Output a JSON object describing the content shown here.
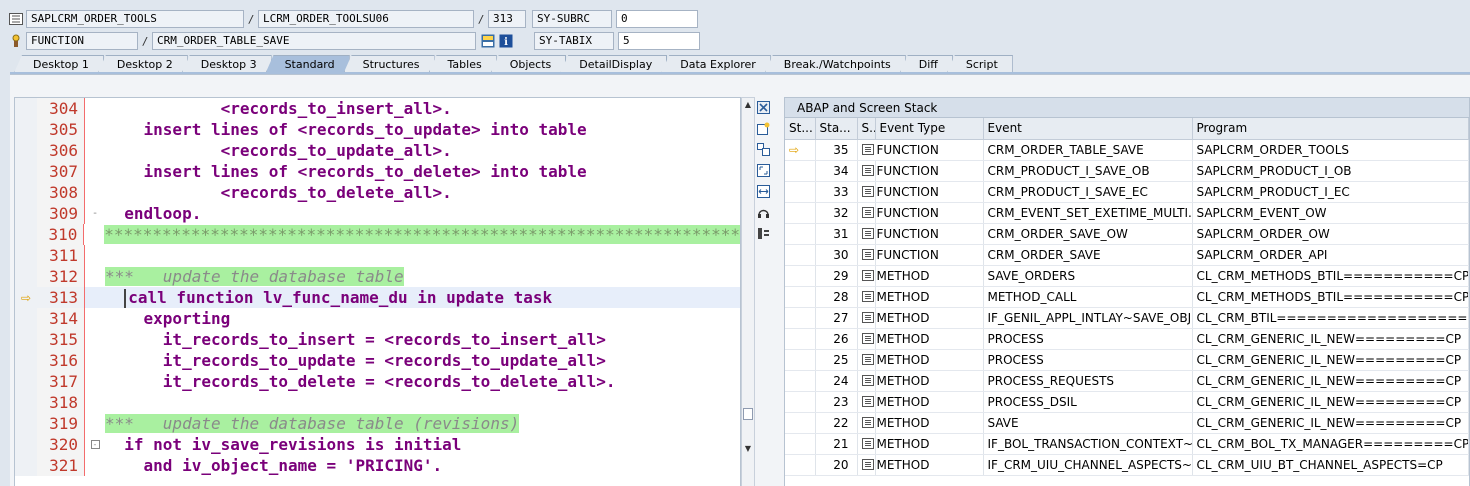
{
  "header": {
    "program": "SAPLCRM_ORDER_TOOLS",
    "include": "LCRM_ORDER_TOOLSU06",
    "line": "313",
    "sysubrc_label": "SY-SUBRC",
    "sysubrc_value": "0",
    "event_type": "FUNCTION",
    "event_name": "CRM_ORDER_TABLE_SAVE",
    "sytabix_label": "SY-TABIX",
    "sytabix_value": "5",
    "sep": "/"
  },
  "tabs": [
    "Desktop 1",
    "Desktop 2",
    "Desktop 3",
    "Standard",
    "Structures",
    "Tables",
    "Objects",
    "DetailDisplay",
    "Data Explorer",
    "Break./Watchpoints",
    "Diff",
    "Script"
  ],
  "active_tab": "Standard",
  "code": [
    {
      "num": "304",
      "text": "            <records_to_insert_all>.",
      "kind": "code"
    },
    {
      "num": "305",
      "text": "    insert lines of <records_to_update> into table",
      "kind": "code"
    },
    {
      "num": "306",
      "text": "            <records_to_update_all>.",
      "kind": "code"
    },
    {
      "num": "307",
      "text": "    insert lines of <records_to_delete> into table",
      "kind": "code"
    },
    {
      "num": "308",
      "text": "            <records_to_delete_all>.",
      "kind": "code"
    },
    {
      "num": "309",
      "text": "  endloop.",
      "kind": "code"
    },
    {
      "num": "310",
      "text": "******************************************************************",
      "kind": "stars"
    },
    {
      "num": "311",
      "text": "",
      "kind": "code"
    },
    {
      "num": "312",
      "text": "***   update the database table",
      "kind": "comment"
    },
    {
      "num": "313",
      "text": "call function lv_func_name_du in update task",
      "kind": "current"
    },
    {
      "num": "314",
      "text": "    exporting",
      "kind": "code"
    },
    {
      "num": "315",
      "text": "      it_records_to_insert = <records_to_insert_all>",
      "kind": "code"
    },
    {
      "num": "316",
      "text": "      it_records_to_update = <records_to_update_all>",
      "kind": "code"
    },
    {
      "num": "317",
      "text": "      it_records_to_delete = <records_to_delete_all>.",
      "kind": "code"
    },
    {
      "num": "318",
      "text": "",
      "kind": "code"
    },
    {
      "num": "319",
      "text": "***   update the database table (revisions)",
      "kind": "comment"
    },
    {
      "num": "320",
      "text": "  if not iv_save_revisions is initial",
      "kind": "code"
    },
    {
      "num": "321",
      "text": "    and iv_object_name = 'PRICING'.",
      "kind": "code"
    }
  ],
  "stack": {
    "title": "ABAP and Screen Stack",
    "columns": [
      "St...",
      "Sta...",
      "S...",
      "Event Type",
      "Event",
      "Program"
    ],
    "rows": [
      {
        "level": "35",
        "type": "FUNCTION",
        "event": "CRM_ORDER_TABLE_SAVE",
        "program": "SAPLCRM_ORDER_TOOLS",
        "current": true
      },
      {
        "level": "34",
        "type": "FUNCTION",
        "event": "CRM_PRODUCT_I_SAVE_OB",
        "program": "SAPLCRM_PRODUCT_I_OB"
      },
      {
        "level": "33",
        "type": "FUNCTION",
        "event": "CRM_PRODUCT_I_SAVE_EC",
        "program": "SAPLCRM_PRODUCT_I_EC"
      },
      {
        "level": "32",
        "type": "FUNCTION",
        "event": "CRM_EVENT_SET_EXETIME_MULTI...",
        "program": "SAPLCRM_EVENT_OW"
      },
      {
        "level": "31",
        "type": "FUNCTION",
        "event": "CRM_ORDER_SAVE_OW",
        "program": "SAPLCRM_ORDER_OW"
      },
      {
        "level": "30",
        "type": "FUNCTION",
        "event": "CRM_ORDER_SAVE",
        "program": "SAPLCRM_ORDER_API"
      },
      {
        "level": "29",
        "type": "METHOD",
        "event": "SAVE_ORDERS",
        "program": "CL_CRM_METHODS_BTIL===========CP"
      },
      {
        "level": "28",
        "type": "METHOD",
        "event": "METHOD_CALL",
        "program": "CL_CRM_METHODS_BTIL===========CP"
      },
      {
        "level": "27",
        "type": "METHOD",
        "event": "IF_GENIL_APPL_INTLAY~SAVE_OBJ...",
        "program": "CL_CRM_BTIL====================CP"
      },
      {
        "level": "26",
        "type": "METHOD",
        "event": "PROCESS",
        "program": "CL_CRM_GENERIC_IL_NEW=========CP"
      },
      {
        "level": "25",
        "type": "METHOD",
        "event": "PROCESS",
        "program": "CL_CRM_GENERIC_IL_NEW=========CP"
      },
      {
        "level": "24",
        "type": "METHOD",
        "event": "PROCESS_REQUESTS",
        "program": "CL_CRM_GENERIC_IL_NEW=========CP"
      },
      {
        "level": "23",
        "type": "METHOD",
        "event": "PROCESS_DSIL",
        "program": "CL_CRM_GENERIC_IL_NEW=========CP"
      },
      {
        "level": "22",
        "type": "METHOD",
        "event": "SAVE",
        "program": "CL_CRM_GENERIC_IL_NEW=========CP"
      },
      {
        "level": "21",
        "type": "METHOD",
        "event": "IF_BOL_TRANSACTION_CONTEXT~...",
        "program": "CL_CRM_BOL_TX_MANAGER=========CP"
      },
      {
        "level": "20",
        "type": "METHOD",
        "event": "IF_CRM_UIU_CHANNEL_ASPECTS~S...",
        "program": "CL_CRM_UIU_BT_CHANNEL_ASPECTS=CP"
      }
    ]
  }
}
